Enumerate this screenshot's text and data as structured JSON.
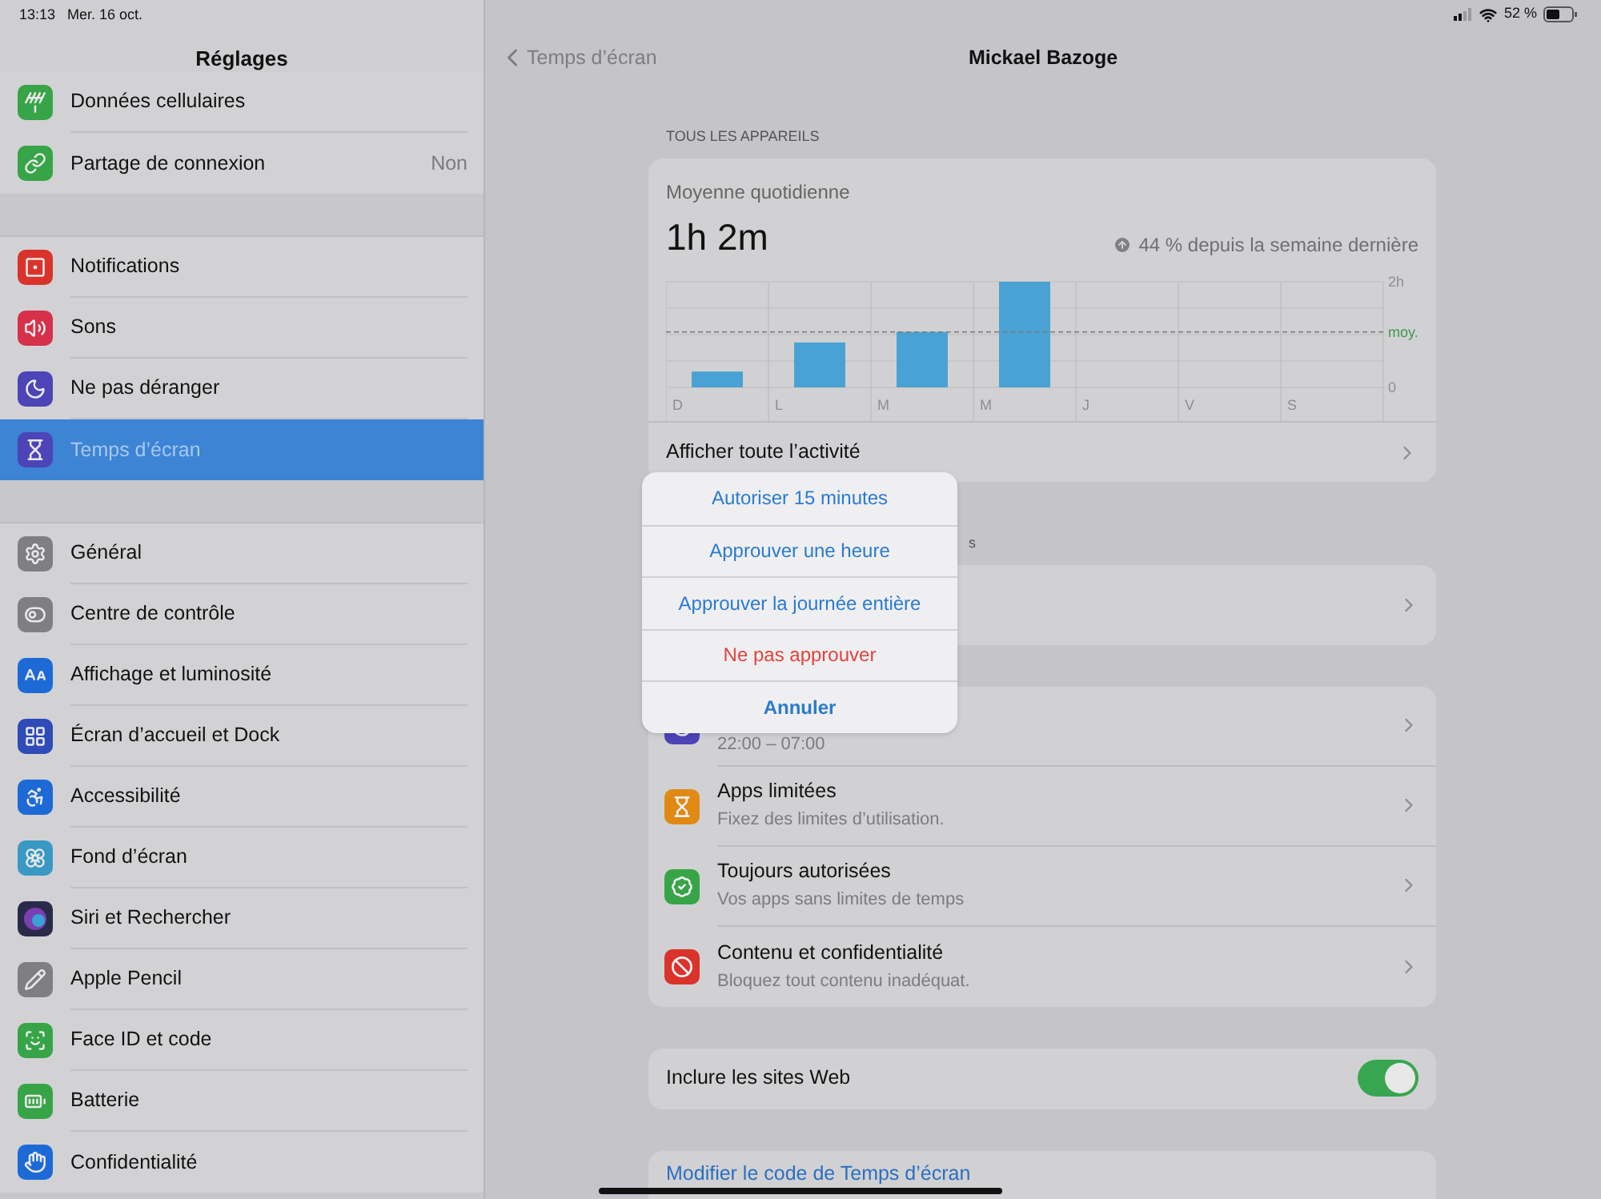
{
  "status_bar": {
    "time": "13:13",
    "date": "Mer. 16 oct.",
    "battery": "52 %"
  },
  "sidebar": {
    "title": "Réglages",
    "groups": [
      [
        {
          "label": "Données cellulaires",
          "color": "#37a447",
          "selected": false
        },
        {
          "label": "Partage de connexion",
          "value": "Non",
          "color": "#37a447",
          "selected": false
        }
      ],
      [
        {
          "label": "Notifications",
          "color": "#d9332b",
          "selected": false
        },
        {
          "label": "Sons",
          "color": "#d6304a",
          "selected": false
        },
        {
          "label": "Ne pas déranger",
          "color": "#4c44b7",
          "selected": false
        },
        {
          "label": "Temps d’écran",
          "color": "#4c44b7",
          "selected": true
        }
      ],
      [
        {
          "label": "Général",
          "color": "#7f7f83",
          "selected": false
        },
        {
          "label": "Centre de contrôle",
          "color": "#7f7f83",
          "selected": false
        },
        {
          "label": "Affichage et luminosité",
          "color": "#1d6ad6",
          "selected": false
        },
        {
          "label": "Écran d’accueil et Dock",
          "color": "#2e4bb7",
          "selected": false
        },
        {
          "label": "Accessibilité",
          "color": "#1d6ad6",
          "selected": false
        },
        {
          "label": "Fond d’écran",
          "color": "#3a98c4",
          "selected": false
        },
        {
          "label": "Siri et Rechercher",
          "color": "#2a2a4a",
          "selected": false
        },
        {
          "label": "Apple Pencil",
          "color": "#7f7f83",
          "selected": false
        },
        {
          "label": "Face ID et code",
          "color": "#37a447",
          "selected": false
        },
        {
          "label": "Batterie",
          "color": "#37a447",
          "selected": false
        },
        {
          "label": "Confidentialité",
          "color": "#1d6ad6",
          "selected": false
        }
      ]
    ]
  },
  "nav": {
    "back": "Temps d’écran",
    "title": "Mickael Bazoge"
  },
  "summary": {
    "header": "TOUS LES APPAREILS",
    "caption": "Moyenne quotidienne",
    "total": "1h 2m",
    "trend": "44 % depuis la semaine dernière",
    "link": "Afficher toute l’activité",
    "chart_data": {
      "type": "bar",
      "categories": [
        "D",
        "L",
        "M",
        "M",
        "J",
        "V",
        "S"
      ],
      "values": [
        0.3,
        0.85,
        1.05,
        2,
        null,
        null,
        null
      ],
      "ylim": [
        0,
        2
      ],
      "yticks": [
        {
          "value": 0,
          "label": "0"
        },
        {
          "value": 2,
          "label": "2h"
        }
      ]
    },
    "average_label": "moy."
  },
  "section_2_header": "s",
  "limits": [
    {
      "subtitle": "22:00 – 07:00",
      "color": "#4c44b7"
    },
    {
      "title": "Apps limitées",
      "subtitle": "Fixez des limites d’utilisation.",
      "color": "#e08a14"
    },
    {
      "title": "Toujours autorisées",
      "subtitle": "Vos apps sans limites de temps",
      "color": "#37a447"
    },
    {
      "title": "Contenu et confidentialité",
      "subtitle": "Bloquez tout contenu inadéquat.",
      "color": "#d9332b"
    }
  ],
  "include_web": {
    "label": "Inclure les sites Web",
    "on": true
  },
  "passcode_link": "Modifier le code de Temps d’écran",
  "action_sheet": [
    {
      "label": "Autoriser 15 minutes",
      "kind": "default"
    },
    {
      "label": "Approuver une heure",
      "kind": "default"
    },
    {
      "label": "Approuver la journée entière",
      "kind": "default"
    },
    {
      "label": "Ne pas approuver",
      "kind": "destructive"
    },
    {
      "label": "Annuler",
      "kind": "cancel"
    }
  ]
}
